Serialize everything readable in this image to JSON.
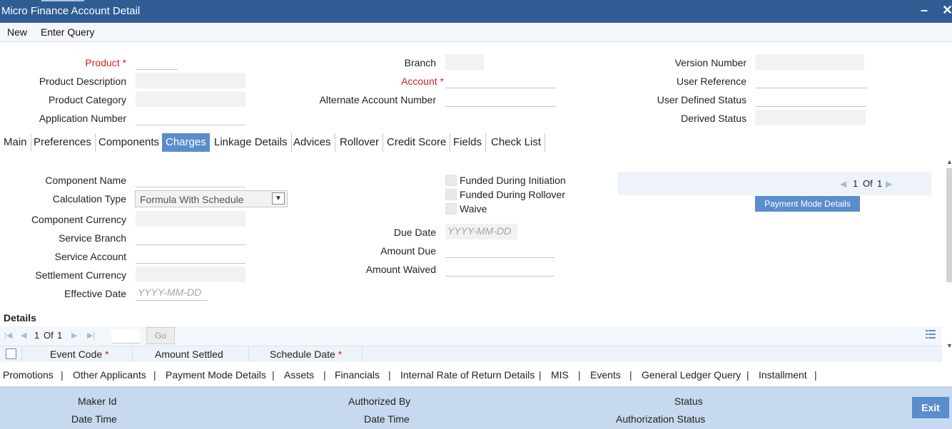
{
  "window": {
    "title": "Micro Finance Account Detail",
    "minimize": "–",
    "close": "✕"
  },
  "menu": {
    "new": "New",
    "enter_query": "Enter Query"
  },
  "header": {
    "product_label": "Product",
    "product_description_label": "Product Description",
    "product_category_label": "Product Category",
    "application_number_label": "Application Number",
    "branch_label": "Branch",
    "account_label": "Account",
    "alternate_account_label": "Alternate Account Number",
    "version_number_label": "Version Number",
    "user_reference_label": "User Reference",
    "user_defined_status_label": "User Defined Status",
    "derived_status_label": "Derived Status",
    "required_marker": "*"
  },
  "tabs": [
    "Main",
    "Preferences",
    "Components",
    "Charges",
    "Linkage Details",
    "Advices",
    "Rollover",
    "Credit Score",
    "Fields",
    "Check List"
  ],
  "active_tab": "Charges",
  "charges": {
    "component_name_label": "Component Name",
    "calculation_type_label": "Calculation Type",
    "calculation_type_value": "Formula With Schedule",
    "component_currency_label": "Component Currency",
    "service_branch_label": "Service Branch",
    "service_account_label": "Service Account",
    "settlement_currency_label": "Settlement Currency",
    "effective_date_label": "Effective Date",
    "date_placeholder": "YYYY-MM-DD",
    "funded_initiation_label": "Funded During Initiation",
    "funded_rollover_label": "Funded During Rollover",
    "waive_label": "Waive",
    "due_date_label": "Due Date",
    "amount_due_label": "Amount Due",
    "amount_waived_label": "Amount Waived",
    "page_current": "1",
    "page_of": "Of",
    "page_total": "1",
    "payment_mode_button": "Payment Mode Details"
  },
  "details": {
    "title": "Details",
    "page_current": "1",
    "page_of": "Of",
    "page_total": "1",
    "go_label": "Go",
    "columns": [
      "Event Code",
      "Amount Settled",
      "Schedule Date"
    ],
    "required_marker": "*"
  },
  "bottom_links": [
    "Promotions",
    "Other Applicants",
    "Payment Mode Details",
    "Assets",
    "Financials",
    "Internal Rate of Return Details",
    "MIS",
    "Events",
    "General Ledger Query",
    "Installment"
  ],
  "link_separator": "|",
  "footer": {
    "maker_id": "Maker Id",
    "date_time": "Date Time",
    "authorized_by": "Authorized By",
    "status": "Status",
    "authorization_status": "Authorization Status",
    "exit": "Exit"
  },
  "colors": {
    "title_bar": "#2f5d93",
    "accent": "#5a8dcc",
    "footer": "#c6d9ee",
    "required": "#d42020"
  }
}
